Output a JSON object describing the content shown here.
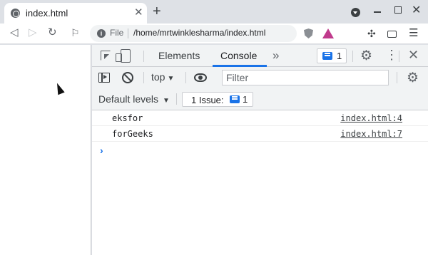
{
  "browser": {
    "tab_title": "index.html",
    "omnibox": {
      "scheme_label": "File",
      "url": "/home/mrtwinklesharma/index.html"
    },
    "icons": [
      "globe-icon",
      "close-icon",
      "plus-icon",
      "back-icon",
      "forward-icon",
      "reload-icon",
      "bookmark-icon",
      "info-icon",
      "brave-shield-icon",
      "brave-rewards-icon",
      "extensions-icon",
      "wallet-icon",
      "menu-icon"
    ]
  },
  "devtools": {
    "tabs": [
      {
        "label": "Elements",
        "active": false
      },
      {
        "label": "Console",
        "active": true
      }
    ],
    "issue_badge_count": "1",
    "context": "top",
    "filter_placeholder": "Filter",
    "levels_label": "Default levels",
    "issues_label": "1 Issue:",
    "issues_count": "1",
    "accent_color": "#1a73e8"
  },
  "console": {
    "messages": [
      {
        "text": "eksfor",
        "source": "index.html:4"
      },
      {
        "text": "forGeeks",
        "source": "index.html:7"
      }
    ],
    "prompt": "›"
  }
}
